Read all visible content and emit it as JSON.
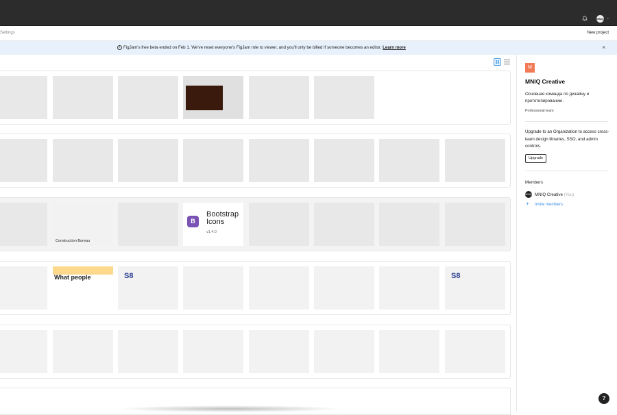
{
  "topbar": {
    "avatar_text": "MNIQ",
    "notification_icon": "bell-icon",
    "chevron_icon": "chevron-down-icon"
  },
  "subbar": {
    "settings_label": "Settings",
    "new_project_label": "New project"
  },
  "banner": {
    "message": "FigJam's free beta ended on Feb 1. We've reset everyone's FigJam role to viewer, and you'll only be billed if someone becomes an editor.",
    "link_label": "Learn more",
    "info_icon": "info-icon",
    "close_icon": "close-icon"
  },
  "view_toggle": {
    "grid_icon": "grid-view-icon",
    "list_icon": "list-view-icon"
  },
  "projects": [
    {
      "thumbnails": [
        {
          "type": "light"
        },
        {
          "type": "light"
        },
        {
          "type": "light"
        },
        {
          "type": "dark"
        },
        {
          "type": "light"
        },
        {
          "type": "light"
        }
      ]
    },
    {
      "thumbnails": [
        {
          "type": "light"
        },
        {
          "type": "light"
        },
        {
          "type": "light"
        },
        {
          "type": "light"
        },
        {
          "type": "light"
        },
        {
          "type": "light"
        },
        {
          "type": "light"
        },
        {
          "type": "light"
        }
      ]
    },
    {
      "thumbnails": [
        {
          "type": "light"
        },
        {
          "type": "label",
          "label": "Construction Bureau"
        },
        {
          "type": "light"
        },
        {
          "type": "bootstrap",
          "title": "Bootstrap Icons",
          "version": "v1.4.0",
          "logo": "B"
        },
        {
          "type": "light"
        },
        {
          "type": "light"
        },
        {
          "type": "light"
        },
        {
          "type": "light"
        }
      ]
    },
    {
      "thumbnails": [
        {
          "type": "light"
        },
        {
          "type": "whatpeople",
          "title": "What people"
        },
        {
          "type": "s8",
          "title": "S8"
        },
        {
          "type": "light"
        },
        {
          "type": "light"
        },
        {
          "type": "light"
        },
        {
          "type": "light"
        },
        {
          "type": "s8",
          "title": "S8"
        }
      ]
    },
    {
      "thumbnails": [
        {
          "type": "light"
        },
        {
          "type": "light"
        },
        {
          "type": "light"
        },
        {
          "type": "light"
        },
        {
          "type": "light"
        },
        {
          "type": "light"
        },
        {
          "type": "light"
        },
        {
          "type": "light"
        }
      ]
    }
  ],
  "sidebar": {
    "team_initial": "M",
    "team_name": "MNIQ Creative",
    "team_description": "Основная команда по дизайну и прототипированию.",
    "plan_label": "Professional team",
    "upgrade_text": "Upgrade to an Organization to access cross-team design libraries, SSO, and admin controls.",
    "upgrade_button": "Upgrade",
    "members_heading": "Members",
    "member_avatar": "MNIQ",
    "member_name": "MNIQ Creative",
    "member_you": "(You)",
    "invite_label": "Invite members"
  },
  "help_label": "?",
  "colors": {
    "topbar": "#2c2c2c",
    "banner": "#e8f1fb",
    "accent": "#3a8ee6",
    "team_square": "#f17b56",
    "bootstrap": "#7952b3"
  }
}
